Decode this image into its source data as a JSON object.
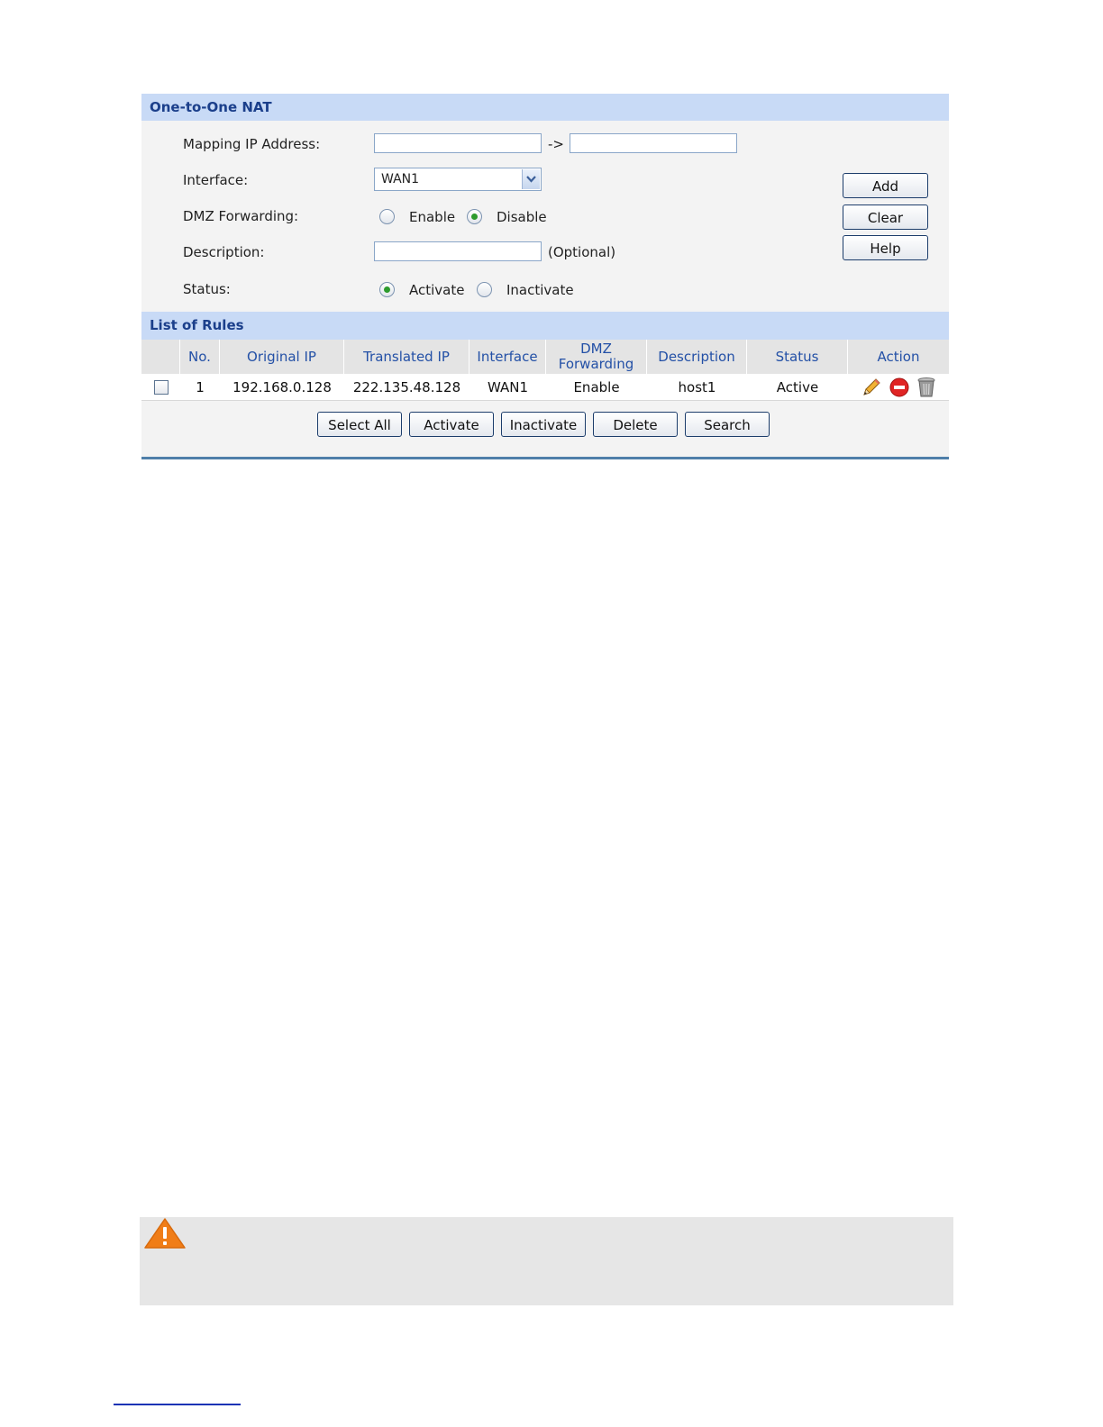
{
  "nat_section": {
    "title": "One-to-One NAT",
    "mapping_label": "Mapping IP Address:",
    "arrow": "->",
    "mapping_from_value": "",
    "mapping_to_value": "",
    "interface_label": "Interface:",
    "interface_value": "WAN1",
    "dmz_label": "DMZ Forwarding:",
    "dmz_enable": "Enable",
    "dmz_disable": "Disable",
    "dmz_selected": "Disable",
    "description_label": "Description:",
    "description_value": "",
    "optional_note": "(Optional)",
    "status_label": "Status:",
    "status_activate": "Activate",
    "status_inactivate": "Inactivate",
    "status_selected": "Activate",
    "buttons": {
      "add": "Add",
      "clear": "Clear",
      "help": "Help"
    }
  },
  "rules_section": {
    "title": "List of Rules",
    "columns": [
      "No.",
      "Original IP",
      "Translated IP",
      "Interface",
      "DMZ Forwarding",
      "Description",
      "Status",
      "Action"
    ],
    "column_dmz_line1": "DMZ",
    "column_dmz_line2": "Forwarding",
    "rows": [
      {
        "no": "1",
        "original_ip": "192.168.0.128",
        "translated_ip": "222.135.48.128",
        "interface": "WAN1",
        "dmz": "Enable",
        "description": "host1",
        "status": "Active"
      }
    ],
    "action_icons": [
      "pencil-edit-icon",
      "red-stop-icon",
      "trash-bin-icon"
    ],
    "buttons": {
      "select_all": "Select All",
      "activate": "Activate",
      "inactivate": "Inactivate",
      "delete": "Delete",
      "search": "Search"
    }
  },
  "colors": {
    "header_bg": "#c8daf6",
    "header_text": "#1b3f8b",
    "column_text": "#2350a6",
    "warning": "#f07d17"
  }
}
